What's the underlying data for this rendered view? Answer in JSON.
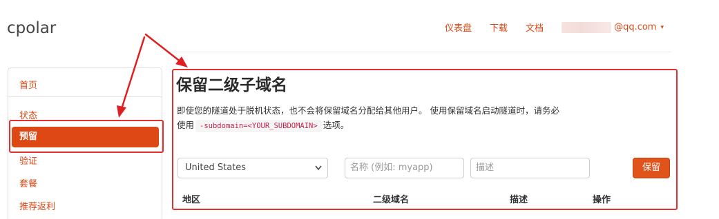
{
  "brand": "cpolar",
  "topnav": {
    "dashboard": "仪表盘",
    "download": "下载",
    "docs": "文档",
    "user_email": "@qq.com",
    "caret": "▾"
  },
  "sidebar": {
    "items": [
      {
        "label": "首页",
        "active": false
      },
      {
        "label": "状态",
        "active": false
      },
      {
        "label": "预留",
        "active": true
      },
      {
        "label": "验证",
        "active": false
      },
      {
        "label": "套餐",
        "active": false
      },
      {
        "label": "推荐返利",
        "active": false
      }
    ]
  },
  "main": {
    "title": "保留二级子域名",
    "desc_part1": "即使您的隧道处于脱机状态，也不会将保留域名分配给其他用户。 使用保留域名启动隧道时，请务必使用",
    "code": "-subdomain=<YOUR_SUBDOMAIN>",
    "desc_part2": "选项。",
    "form": {
      "region_value": "United States",
      "name_placeholder": "名称 (例如: myapp)",
      "desc_placeholder": "描述",
      "save_label": "保留"
    },
    "table_headers": [
      "地区",
      "二级域名",
      "描述",
      "操作"
    ]
  },
  "colors": {
    "accent": "#dd4814",
    "highlight_box": "#e03030"
  },
  "icons": {
    "select": "chevron-down-icon",
    "user_menu": "caret-down-icon"
  }
}
